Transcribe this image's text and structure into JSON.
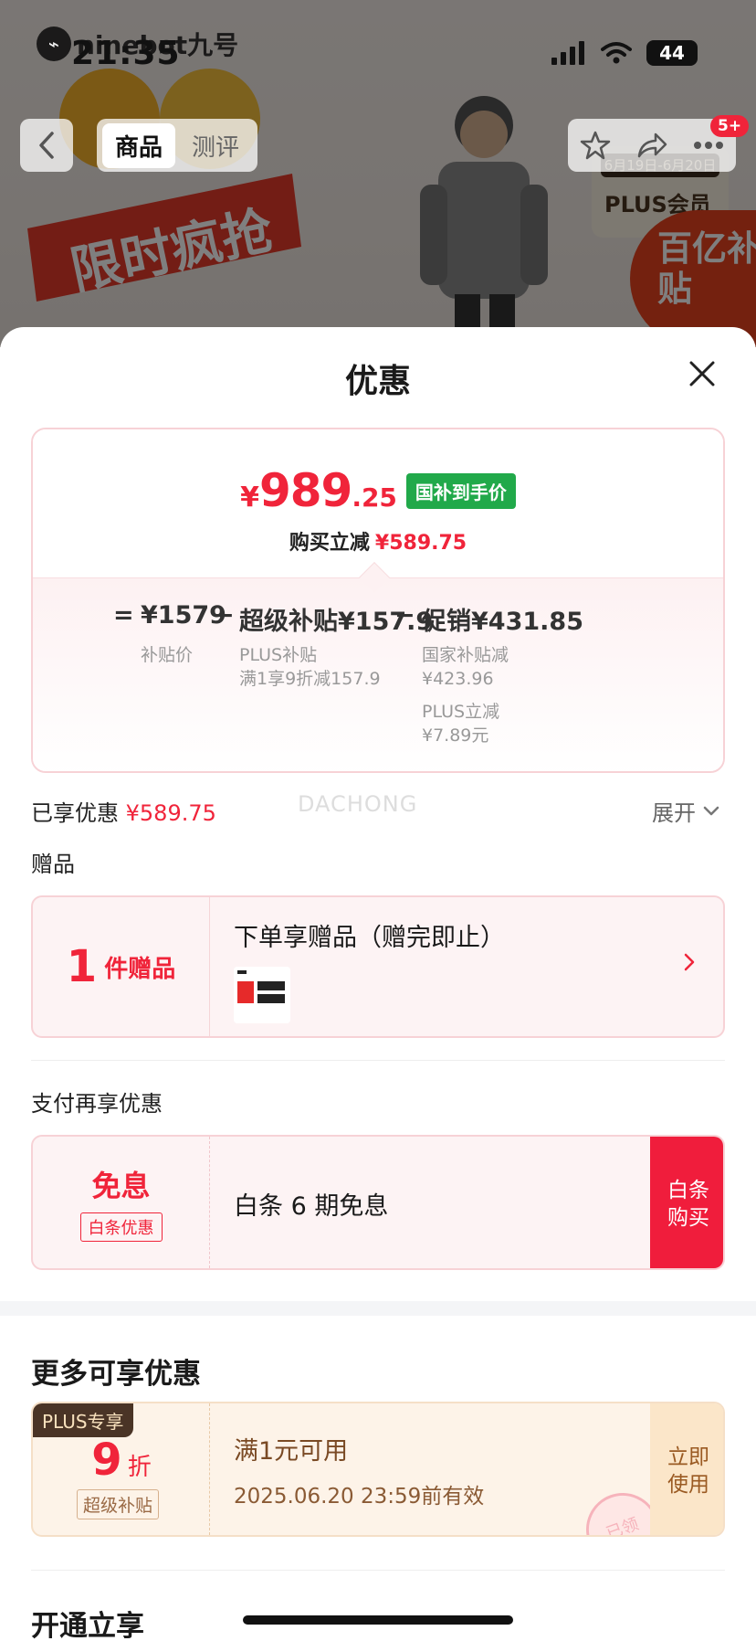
{
  "status_bar": {
    "time": "21:35",
    "brand": "ninebot九号",
    "battery": "44"
  },
  "nav": {
    "tabs": [
      {
        "label": "商品",
        "active": true
      },
      {
        "label": "测评",
        "active": false
      }
    ],
    "cart_badge": "5+"
  },
  "background_banner": {
    "promo_text": "限时疯抢",
    "plus_dates": "6月19日-6月20日",
    "plus_label": "PLUS会员",
    "subsidy_label": "百亿补贴"
  },
  "sheet": {
    "title": "优惠",
    "price": {
      "currency": "¥",
      "integer": "989",
      "decimal": ".25",
      "tag": "国补到手价",
      "reduce_label": "购买立减",
      "reduce_amount": "¥589.75"
    },
    "formula": {
      "eq": "=",
      "base_value": "¥1579",
      "base_label": "补贴价",
      "minus": "−",
      "super_label": "超级补贴",
      "super_value": "¥157.9",
      "super_sub1": "PLUS补贴",
      "super_sub2": "满1享9折减157.9",
      "promo_label": "促销",
      "promo_value": "¥431.85",
      "promo_sub1": "国家补贴减",
      "promo_sub2": "¥423.96",
      "promo_sub3": "PLUS立减",
      "promo_sub4": "¥7.89元"
    },
    "enjoyed_label": "已享优惠",
    "enjoyed_amount": "¥589.75",
    "expand_label": "展开",
    "watermark": "DACHONG",
    "gift_section": "赠品",
    "gift": {
      "count": "1",
      "unit": "件赠品",
      "title": "下单享赠品（赠完即止）"
    },
    "pay_section": "支付再享优惠",
    "pay": {
      "big": "免息",
      "small": "白条优惠",
      "text": "白条 6 期免息",
      "button": "白条\n购买"
    },
    "more_section": "更多可享优惠",
    "coupon": {
      "tag": "PLUS专享",
      "discount": "9",
      "discount_unit": "折",
      "label": "超级补贴",
      "condition": "满1元可用",
      "validity": "2025.06.20 23:59前有效",
      "button": "立即\n使用",
      "stamp": "已领"
    },
    "open_section": "开通立享"
  },
  "colors": {
    "accent_red": "#f0243a",
    "green_tag": "#21a94a",
    "coupon_brown": "#7a4a24"
  }
}
